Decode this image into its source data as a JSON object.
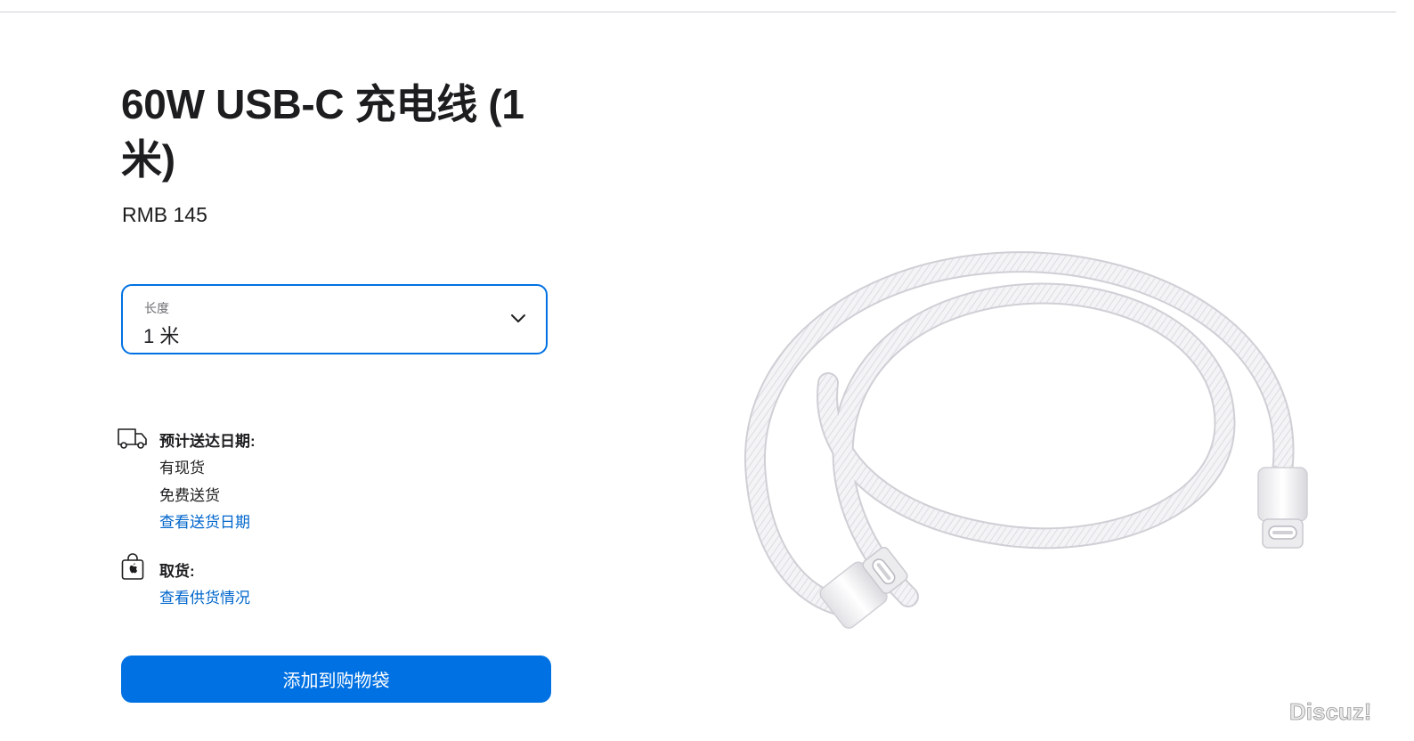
{
  "product": {
    "title": "60W USB-C 充电线 (1 米)",
    "price": "RMB 145"
  },
  "length_select": {
    "label": "长度",
    "value": "1 米"
  },
  "delivery": {
    "icon": "delivery-truck-icon",
    "title": "预计送达日期:",
    "stock": "有现货",
    "shipping": "免费送货",
    "link": "查看送货日期"
  },
  "pickup": {
    "icon": "apple-bag-icon",
    "title": "取货:",
    "link": "查看供货情况"
  },
  "cta": {
    "add_to_bag": "添加到购物袋"
  },
  "watermark": {
    "text": "Discuz!"
  },
  "colors": {
    "accent": "#0071e3",
    "link": "#0066cc",
    "text": "#1d1d1f",
    "secondary_text": "#6e6e73"
  }
}
